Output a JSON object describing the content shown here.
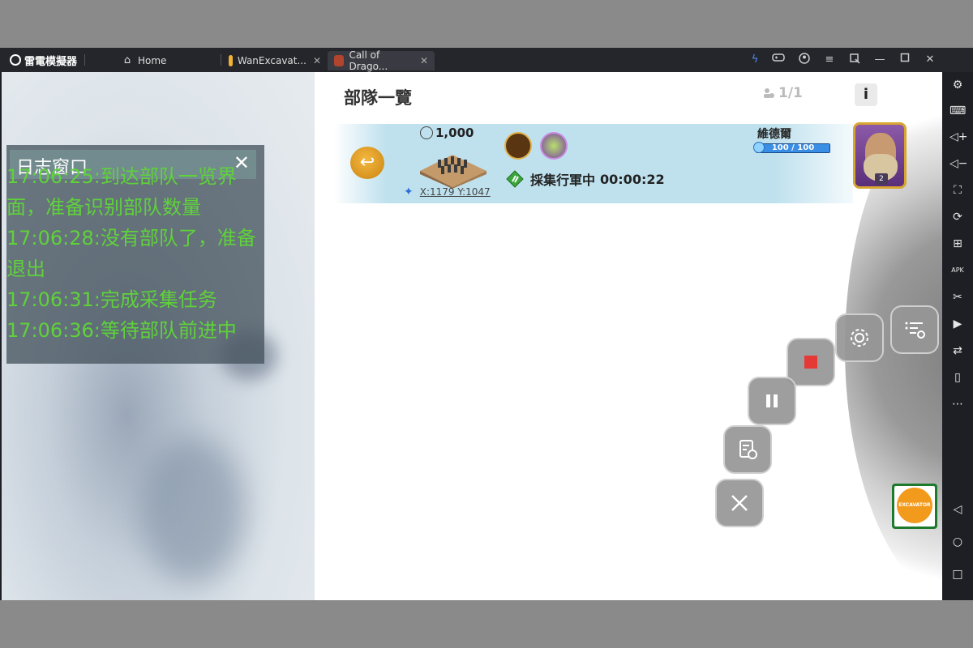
{
  "app": {
    "brand": "雷電模擬器",
    "tabs": [
      {
        "label": "Home",
        "icon": "home-icon",
        "active": false
      },
      {
        "label": "WanExcavat...",
        "icon": "excavator-app-icon",
        "active": false
      },
      {
        "label": "Call of Drago...",
        "icon": "call-of-dragons-icon",
        "active": true
      }
    ],
    "tab_close": "✕",
    "window_controls": [
      "lightning-icon",
      "gamepad-icon",
      "account-icon",
      "menu-icon",
      "screenshot-icon",
      "minimize-icon",
      "maximize-icon",
      "close-icon"
    ]
  },
  "game": {
    "page_title": "部隊一覽",
    "troop_count": "1/1",
    "info_label": "i",
    "troop": {
      "resource": "1,000",
      "coords": "X:1179 Y:1047",
      "status": "採集行軍中",
      "timer": "00:00:22",
      "commander": "維德爾",
      "hp": "100 / 100",
      "hp_fraction": 1.0,
      "level": "2"
    }
  },
  "log_window": {
    "title": "日志窗口",
    "close": "✕",
    "lines": [
      "17:06:25:到达部队一览界面，准备识别部队数量",
      "17:06:28:没有部队了，准备退出",
      "17:06:31:完成采集任务",
      "17:06:36:等待部队前进中"
    ]
  },
  "floating_controls": [
    "settings-icon",
    "script-list-icon",
    "stop-icon",
    "pause-icon",
    "log-icon",
    "close-icon"
  ],
  "excavator_label": "EXCAVATOR",
  "sidebar_icons": [
    "settings-icon",
    "keyboard-icon",
    "volume-up-icon",
    "volume-down-icon",
    "fullscreen-icon",
    "sync-icon",
    "add-icon",
    "apk-icon",
    "cut-icon",
    "record-icon",
    "transfer-icon",
    "shake-icon",
    "more-icon",
    "back-icon",
    "home-circle-icon",
    "recent-apps-icon"
  ],
  "colors": {
    "log_text": "#5fd23a",
    "stop_red": "#e53935",
    "accent_gold": "#d9a531"
  }
}
